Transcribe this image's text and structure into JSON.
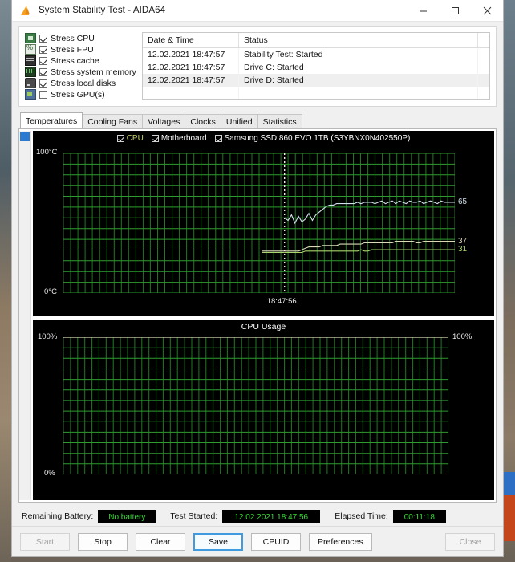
{
  "window": {
    "title": "System Stability Test - AIDA64",
    "app_icon": "flame-icon",
    "minimize_label": "─",
    "maximize_label": "□",
    "close_label": "✕"
  },
  "stress_options": [
    {
      "label": "Stress CPU",
      "checked": true,
      "icon": "cpu-icon"
    },
    {
      "label": "Stress FPU",
      "checked": true,
      "icon": "fpu-icon"
    },
    {
      "label": "Stress cache",
      "checked": true,
      "icon": "cache-icon"
    },
    {
      "label": "Stress system memory",
      "checked": true,
      "icon": "memory-icon"
    },
    {
      "label": "Stress local disks",
      "checked": true,
      "icon": "disk-icon"
    },
    {
      "label": "Stress GPU(s)",
      "checked": false,
      "icon": "gpu-icon"
    }
  ],
  "log": {
    "columns": [
      "Date & Time",
      "Status"
    ],
    "rows": [
      {
        "datetime": "12.02.2021 18:47:57",
        "status": "Stability Test: Started"
      },
      {
        "datetime": "12.02.2021 18:47:57",
        "status": "Drive C: Started"
      },
      {
        "datetime": "12.02.2021 18:47:57",
        "status": "Drive D: Started"
      }
    ]
  },
  "tabs": [
    {
      "label": "Temperatures",
      "active": true
    },
    {
      "label": "Cooling Fans",
      "active": false
    },
    {
      "label": "Voltages",
      "active": false
    },
    {
      "label": "Clocks",
      "active": false
    },
    {
      "label": "Unified",
      "active": false
    },
    {
      "label": "Statistics",
      "active": false
    }
  ],
  "chart_data": [
    {
      "type": "line",
      "title": "",
      "ylabel": "",
      "xlabel": "",
      "ylim": [
        0,
        100
      ],
      "y_top_label": "100°C",
      "y_bottom_label": "0°C",
      "grid": true,
      "legend_position": "top-center",
      "time_marker_label": "18:47:56",
      "series": [
        {
          "name": "CPU",
          "color": "#cfe0ea",
          "current_value": 65,
          "value_label": "65",
          "checked": true,
          "values": [
            54,
            52,
            56,
            50,
            55,
            51,
            53,
            57,
            52,
            56,
            58,
            60,
            62,
            63,
            63,
            64,
            64,
            64,
            64,
            64,
            64,
            65,
            64,
            65,
            65,
            65,
            64,
            65,
            66,
            64,
            65,
            66,
            64,
            66,
            65,
            64,
            66,
            65,
            65,
            66,
            64,
            65,
            66,
            65,
            64,
            66,
            65,
            65,
            65,
            65
          ]
        },
        {
          "name": "Motherboard",
          "color": "#d9d9b8",
          "current_value": 37,
          "value_label": "37",
          "checked": true,
          "values": [
            30,
            30,
            30,
            30,
            30,
            31,
            32,
            33,
            33,
            33,
            33,
            34,
            34,
            34,
            34,
            34,
            35,
            35,
            35,
            35,
            35,
            35,
            35,
            36,
            36,
            36,
            36,
            36,
            36,
            36,
            36,
            36,
            37,
            37,
            37,
            37,
            37,
            37,
            36,
            36,
            37,
            37,
            37,
            37,
            37,
            37,
            37,
            37,
            37,
            37
          ]
        },
        {
          "name": "Samsung SSD 860 EVO 1TB (S3YBNX0N402550P)",
          "color": "#a9d46a",
          "current_value": 31,
          "value_label": "31",
          "checked": true,
          "values": [
            29,
            29,
            29,
            29,
            29,
            29,
            30,
            30,
            30,
            30,
            30,
            30,
            30,
            30,
            30,
            30,
            30,
            30,
            30,
            30,
            30,
            30,
            31,
            30,
            30,
            31,
            31,
            31,
            31,
            31,
            31,
            31,
            31,
            31,
            31,
            31,
            31,
            31,
            31,
            31,
            31,
            31,
            31,
            31,
            31,
            31,
            31,
            31,
            31,
            31
          ]
        }
      ]
    },
    {
      "type": "line",
      "title": "CPU Usage",
      "ylim": [
        0,
        100
      ],
      "y_top_label": "100%",
      "y_top_label_right": "100%",
      "y_bottom_label": "0%",
      "grid": true,
      "series": [
        {
          "name": "CPU Usage",
          "color": "#d9d9b8",
          "current_value": 100,
          "values": [
            100,
            100,
            100,
            100,
            100,
            100,
            100,
            100,
            100,
            100,
            100,
            100,
            100,
            100,
            100,
            100,
            100,
            100,
            100,
            100,
            100,
            100,
            100,
            100,
            100,
            100,
            100,
            100,
            100,
            100,
            100,
            100,
            100,
            100,
            100,
            100,
            100,
            100,
            100,
            100,
            100,
            100,
            100,
            100,
            100,
            100,
            100,
            100,
            100,
            100
          ]
        }
      ]
    }
  ],
  "status": {
    "battery_label": "Remaining Battery:",
    "battery_value": "No battery",
    "started_label": "Test Started:",
    "started_value": "12.02.2021 18:47:56",
    "elapsed_label": "Elapsed Time:",
    "elapsed_value": "00:11:18"
  },
  "buttons": [
    {
      "label": "Start",
      "disabled": true,
      "focused": false
    },
    {
      "label": "Stop",
      "disabled": false,
      "focused": false
    },
    {
      "label": "Clear",
      "disabled": false,
      "focused": false
    },
    {
      "label": "Save",
      "disabled": false,
      "focused": true
    },
    {
      "label": "CPUID",
      "disabled": false,
      "focused": false
    },
    {
      "label": "Preferences",
      "disabled": false,
      "focused": false
    },
    {
      "label": "Close",
      "disabled": true,
      "focused": false
    }
  ]
}
